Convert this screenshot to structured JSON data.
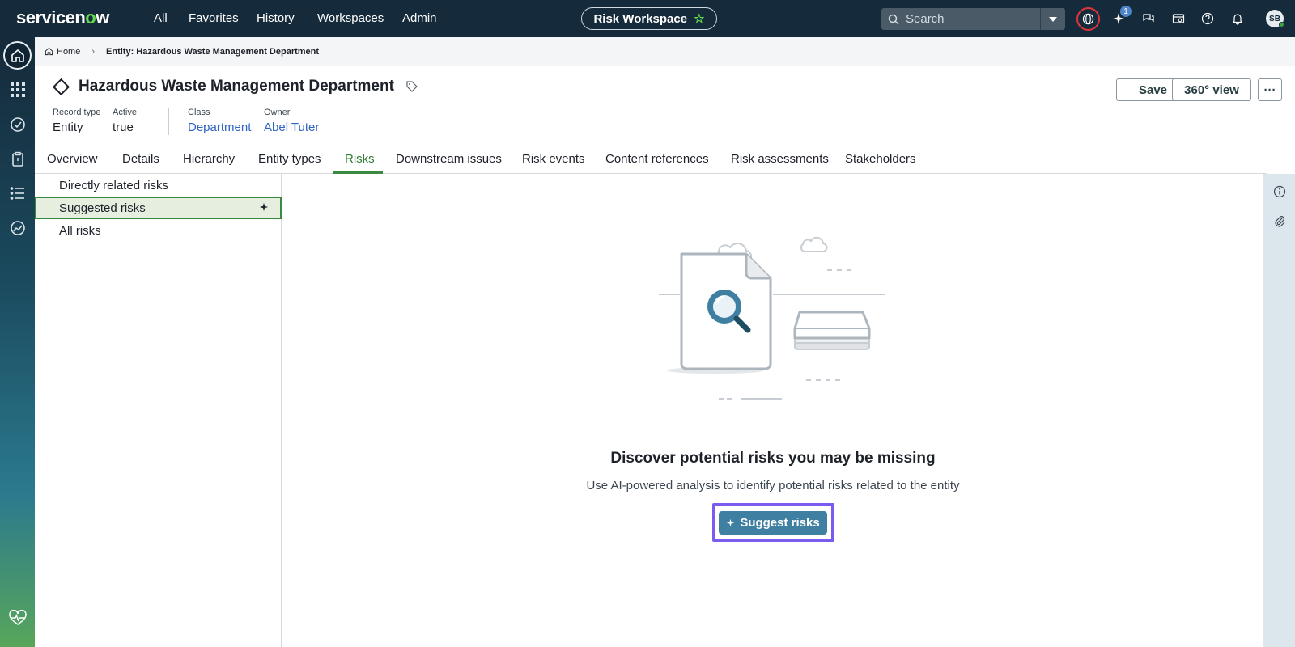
{
  "brand": {
    "logo_pre": "servicen",
    "logo_o": "o",
    "logo_post": "w"
  },
  "topnav": {
    "items": [
      "All",
      "Favorites",
      "History",
      "Workspaces",
      "Admin"
    ]
  },
  "workspace": {
    "label": "Risk Workspace"
  },
  "search": {
    "placeholder": "Search"
  },
  "notifications": {
    "badge_count": "1"
  },
  "user": {
    "initials": "SB"
  },
  "breadcrumb": {
    "home": "Home",
    "current": "Entity: Hazardous Waste Management Department"
  },
  "record": {
    "title": "Hazardous Waste Management Department",
    "fields": [
      {
        "label": "Record type",
        "value": "Entity"
      },
      {
        "label": "Active",
        "value": "true"
      },
      {
        "label": "Class",
        "value": "Department"
      },
      {
        "label": "Owner",
        "value": "Abel Tuter"
      }
    ],
    "actions": {
      "save": "Save",
      "view360": "360° view",
      "more": "···"
    }
  },
  "tabs": [
    "Overview",
    "Details",
    "Hierarchy",
    "Entity types",
    "Risks",
    "Downstream issues",
    "Risk events",
    "Content references",
    "Risk assessments",
    "Stakeholders"
  ],
  "active_tab": "Risks",
  "risk_views": [
    "Directly related risks",
    "Suggested risks",
    "All risks"
  ],
  "selected_view": "Suggested risks",
  "empty_state": {
    "title": "Discover potential risks you may be missing",
    "subtitle": "Use AI-powered analysis to identify potential risks related to the entity",
    "button": "Suggest risks"
  },
  "colors": {
    "nav_bg": "#152a3a",
    "accent_green": "#3b8a3f",
    "primary_button": "#3f7fa1",
    "focus_ring": "#7c5cf0",
    "link": "#2f64c1"
  }
}
